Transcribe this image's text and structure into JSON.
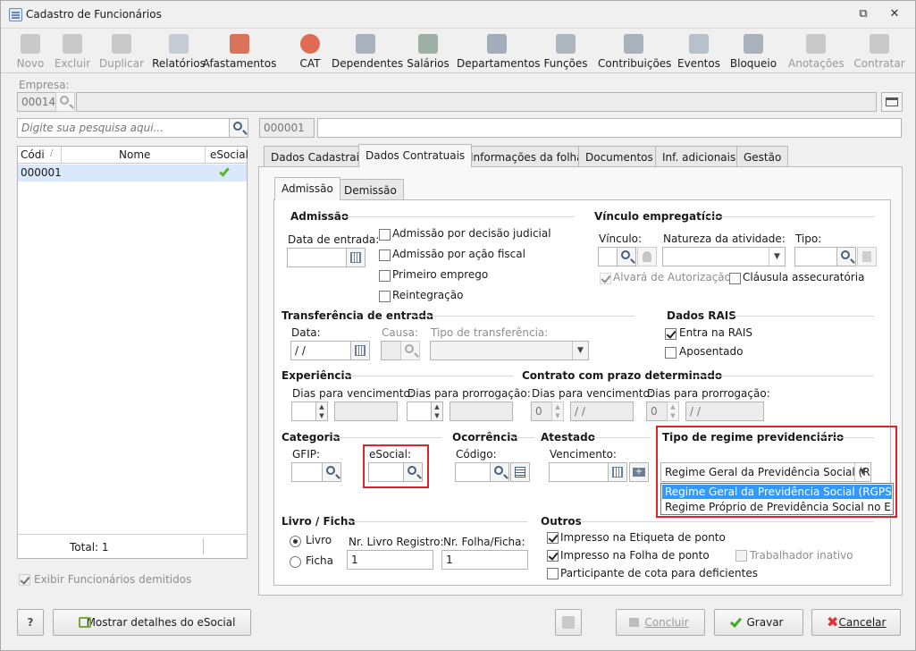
{
  "window": {
    "title": "Cadastro de Funcionários"
  },
  "toolbar": [
    {
      "label": "Novo",
      "icon": "new-doc-icon",
      "enabled": false
    },
    {
      "label": "Excluir",
      "icon": "trash-icon",
      "enabled": false
    },
    {
      "label": "Duplicar",
      "icon": "users-icon",
      "enabled": false
    },
    {
      "label": "Relatórios",
      "icon": "report-icon",
      "enabled": true
    },
    {
      "label": "Afastamentos",
      "icon": "house-arrow-icon",
      "enabled": true
    },
    {
      "label": "CAT",
      "icon": "medical-cross-icon",
      "enabled": true
    },
    {
      "label": "Dependentes",
      "icon": "family-icon",
      "enabled": true
    },
    {
      "label": "Salários",
      "icon": "money-icon",
      "enabled": true
    },
    {
      "label": "Departamentos",
      "icon": "desk-icon",
      "enabled": true
    },
    {
      "label": "Funções",
      "icon": "badge-icon",
      "enabled": true
    },
    {
      "label": "Contribuições",
      "icon": "people-icon",
      "enabled": true
    },
    {
      "label": "Eventos",
      "icon": "list-icon",
      "enabled": true
    },
    {
      "label": "Bloqueio",
      "icon": "lock-icon",
      "enabled": true
    },
    {
      "label": "Anotações",
      "icon": "note-edit-icon",
      "enabled": false
    },
    {
      "label": "Contratar",
      "icon": "contract-icon",
      "enabled": false
    }
  ],
  "empresa": {
    "label": "Empresa:",
    "code": "00014",
    "name": ""
  },
  "search": {
    "placeholder": "Digite sua pesquisa aqui...",
    "code": "000001",
    "name": ""
  },
  "grid": {
    "columns": [
      "Códi",
      "Nome",
      "eSocial"
    ],
    "rows": [
      {
        "code": "000001",
        "name": "",
        "esocial": "check"
      }
    ],
    "total": "Total: 1"
  },
  "show_dismissed": "Exibir Funcionários demitidos",
  "tabs": [
    "Dados Cadastrais",
    "Dados Contratuais",
    "Informações da folha",
    "Documentos",
    "Inf. adicionais",
    "Gestão"
  ],
  "subtabs": [
    "Admissão",
    "Demissão"
  ],
  "admissao": {
    "title": "Admissão",
    "data_entrada": "Data de entrada:",
    "checks": [
      "Admissão por decisão judicial",
      "Admissão por ação fiscal",
      "Primeiro emprego",
      "Reintegração"
    ]
  },
  "vinculo": {
    "title": "Vínculo empregatício",
    "vinculo": "Vínculo:",
    "natureza": "Natureza da atividade:",
    "tipo": "Tipo:",
    "alvara": "Alvará de Autorização",
    "clausula": "Cláusula assecuratória"
  },
  "transferencia": {
    "title": "Transferência de entrada",
    "data": "Data:",
    "data_value": " / /",
    "causa": "Causa:",
    "tipo": "Tipo de transferência:"
  },
  "rais": {
    "title": "Dados RAIS",
    "entra": "Entra na RAIS",
    "aposentado": "Aposentado"
  },
  "experiencia": {
    "title": "Experiência",
    "dias_venc": "Dias para vencimento:",
    "dias_prorr": "Dias para prorrogação:"
  },
  "contrato": {
    "title": "Contrato com prazo determinado",
    "dias_venc": "Dias para vencimento:",
    "dias_prorr": "Dias para prorrogação:",
    "venc_num": "0",
    "venc_date": " / /",
    "prorr_num": "0",
    "prorr_date": " / /"
  },
  "categoria": {
    "title": "Categoria",
    "gfip": "GFIP:",
    "esocial": "eSocial:"
  },
  "ocorrencia": {
    "title": "Ocorrência",
    "codigo": "Código:"
  },
  "atestado": {
    "title": "Atestado",
    "vencimento": "Vencimento:"
  },
  "regime": {
    "title": "Tipo de regime previdenciário",
    "selected": "Regime Geral da Previdência Social (RGP",
    "options": [
      "Regime Geral da Previdência Social (RGPS)",
      "Regime Próprio de Previdência Social no Exterior"
    ]
  },
  "livro": {
    "title": "Livro / Ficha",
    "livro": "Livro",
    "ficha": "Ficha",
    "nr_livro": "Nr. Livro Registro:",
    "nr_folha": "Nr. Folha/Ficha:",
    "nr_livro_value": "1",
    "nr_folha_value": "1"
  },
  "outros": {
    "title": "Outros",
    "etiqueta": "Impresso na Etiqueta de ponto",
    "folha": "Impresso na Folha de ponto",
    "inativo": "Trabalhador inativo",
    "cota": "Participante de cota para deficientes"
  },
  "footer": {
    "help": "?",
    "esocial_details": "Mostrar detalhes do eSocial",
    "concluir": "Concluir",
    "gravar": "Gravar",
    "cancelar": "Cancelar"
  },
  "colors": {
    "accent_red": "#d6262b",
    "selection": "#3399ff",
    "row_selected": "#d9e8fb"
  }
}
